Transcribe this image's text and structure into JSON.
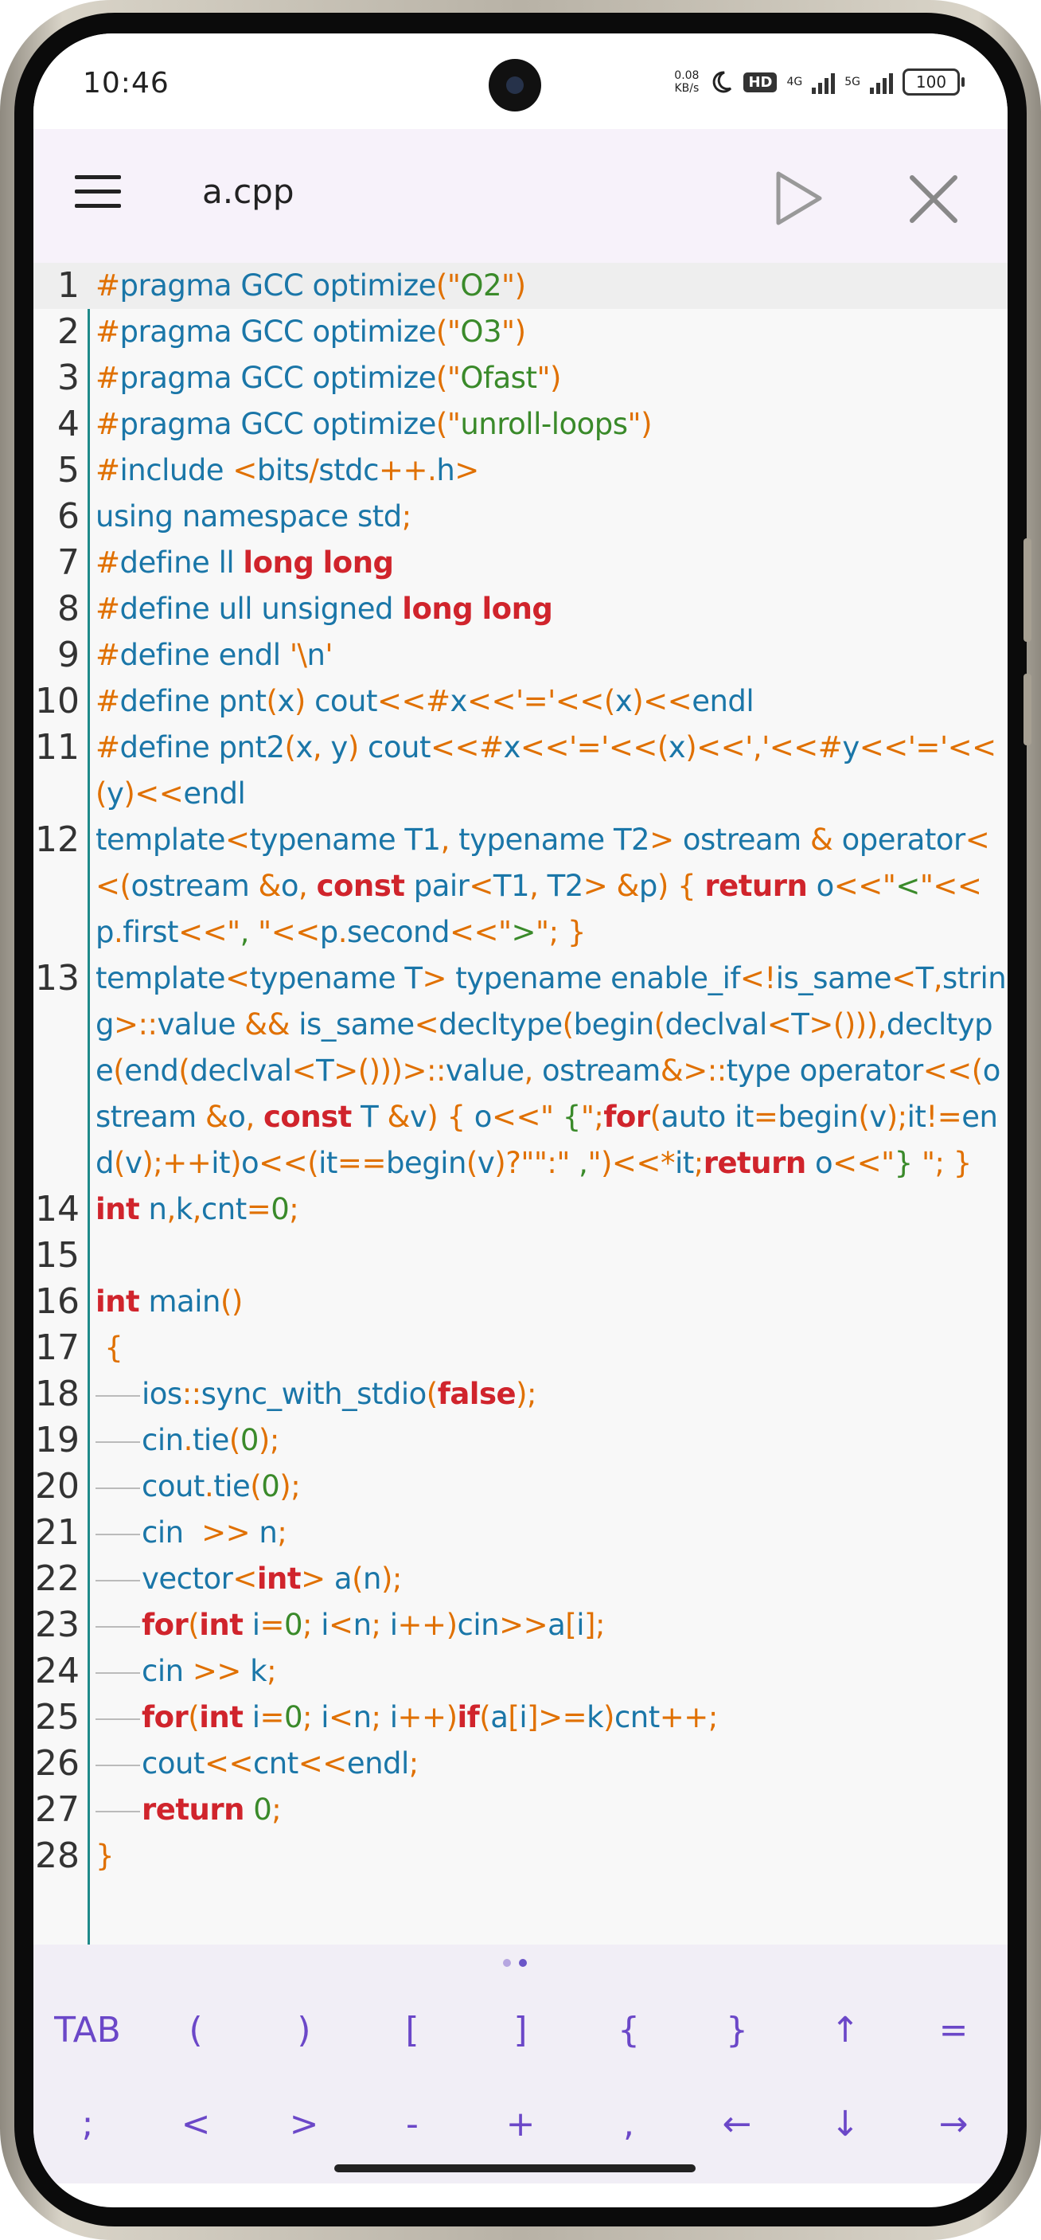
{
  "status_bar": {
    "time": "10:46",
    "net_speed_value": "0.08",
    "net_speed_unit": "KB/s",
    "hd_label": "HD",
    "net1": "4G",
    "net2": "5G",
    "battery": "100"
  },
  "app_bar": {
    "title": "a.cpp",
    "icons": [
      "menu-icon",
      "play-icon",
      "close-icon"
    ]
  },
  "editor": {
    "lines": [
      {
        "num": "1",
        "text": "#pragma GCC optimize(\"O2\")"
      },
      {
        "num": "2",
        "text": "#pragma GCC optimize(\"O3\")"
      },
      {
        "num": "3",
        "text": "#pragma GCC optimize(\"Ofast\")"
      },
      {
        "num": "4",
        "text": "#pragma GCC optimize(\"unroll-loops\")"
      },
      {
        "num": "5",
        "text": "#include <bits/stdc++.h>"
      },
      {
        "num": "6",
        "text": "using namespace std;"
      },
      {
        "num": "7",
        "text": "#define ll long long"
      },
      {
        "num": "8",
        "text": "#define ull unsigned long long"
      },
      {
        "num": "9",
        "text": "#define endl '\\n'"
      },
      {
        "num": "10",
        "text": "#define pnt(x) cout<<#x<<'='<<(x)<<endl"
      },
      {
        "num": "11",
        "text": "#define pnt2(x, y) cout<<#x<<'='<<(x)<<','<<#y<<'='<<(y)<<endl"
      },
      {
        "num": "12",
        "text": "template<typename T1, typename T2> ostream & operator<<(ostream &o, const pair<T1, T2> &p) { return o<<\"<\"<<p.first<<\", \"<<p.second<<\">\"; }"
      },
      {
        "num": "13",
        "text": "template<typename T> typename enable_if<!is_same<T,string>::value && is_same<decltype(begin(declval<T>())),decltype(end(declval<T>()))>::value, ostream&>::type operator<<(ostream &o, const T &v) { o<<\" {\";for(auto it=begin(v);it!=end(v);++it)o<<(it==begin(v)?\"\":\" ,\")<<*it;return o<<\"} \"; }"
      },
      {
        "num": "14",
        "text": "int n,k,cnt=0;"
      },
      {
        "num": "15",
        "text": ""
      },
      {
        "num": "16",
        "text": "int main()"
      },
      {
        "num": "17",
        "text": " {"
      },
      {
        "num": "18",
        "text": "ios::sync_with_stdio(false);",
        "indent": 1
      },
      {
        "num": "19",
        "text": "cin.tie(0);",
        "indent": 1
      },
      {
        "num": "20",
        "text": "cout.tie(0);",
        "indent": 1
      },
      {
        "num": "21",
        "text": "cin  >> n;",
        "indent": 1
      },
      {
        "num": "22",
        "text": "vector<int> a(n);",
        "indent": 1
      },
      {
        "num": "23",
        "text": "for(int i=0; i<n; i++)cin>>a[i];",
        "indent": 1
      },
      {
        "num": "24",
        "text": "cin >> k;",
        "indent": 1
      },
      {
        "num": "25",
        "text": "for(int i=0; i<n; i++)if(a[i]>=k)cnt++;",
        "indent": 1
      },
      {
        "num": "26",
        "text": "cout<<cnt<<endl;",
        "indent": 1
      },
      {
        "num": "27",
        "text": "return 0;",
        "indent": 1
      },
      {
        "num": "28",
        "text": "}"
      }
    ]
  },
  "symbol_bar": {
    "row1": [
      "TAB",
      "(",
      ")",
      "[",
      "]",
      "{",
      "}",
      "↑",
      "="
    ],
    "row2": [
      ";",
      "<",
      ">",
      "-",
      "+",
      ",",
      "←",
      "↓",
      "→"
    ]
  },
  "colors": {
    "keyword": "#d0242c",
    "symbol": "#e07000",
    "identifier": "#1a76a8",
    "string": "#3a8a2a",
    "key_text": "#6b47c8"
  }
}
